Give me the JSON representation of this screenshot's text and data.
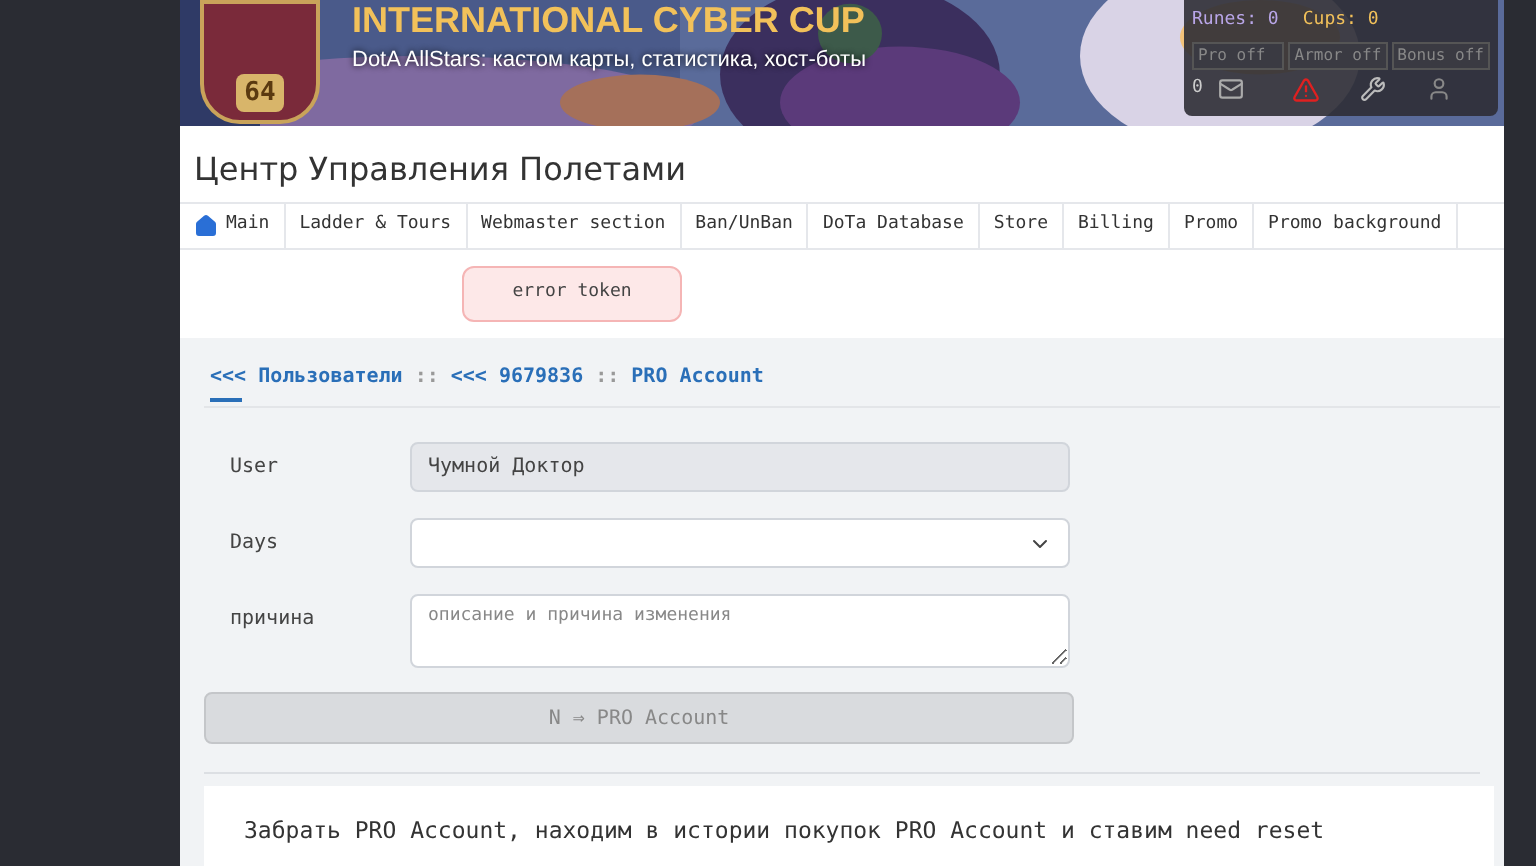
{
  "banner": {
    "title": "INTERNATIONAL CYBER CUP",
    "subtitle": "DotA AllStars: кастом карты, статистика, хост-боты",
    "level": "64",
    "stats": {
      "runes": "Runes: 0",
      "cups": "Cups: 0",
      "toggles": [
        {
          "label": "Pro off",
          "on": false
        },
        {
          "label": "Armor off",
          "on": false
        },
        {
          "label": "Bonus off",
          "on": false
        }
      ],
      "messages": "0"
    }
  },
  "page_title": "Центр Управления Полетами",
  "nav": [
    {
      "label": "Main",
      "kind": "home"
    },
    {
      "label": "Ladder & Tours",
      "kind": "text"
    },
    {
      "label": "Webmaster section",
      "kind": "text"
    },
    {
      "label": "Ban/UnBan",
      "kind": "text"
    },
    {
      "label": "DoTa Database",
      "kind": "text"
    },
    {
      "label": "Store",
      "kind": "text"
    },
    {
      "label": "Billing",
      "kind": "text"
    },
    {
      "label": "Promo",
      "kind": "text"
    },
    {
      "label": "Promo background",
      "kind": "text"
    }
  ],
  "alert": "error token",
  "breadcrumb": [
    {
      "label": "<<< Пользователи",
      "kind": "link"
    },
    {
      "label": "::",
      "kind": "sep"
    },
    {
      "label": "<<< 9679836",
      "kind": "link"
    },
    {
      "label": "::",
      "kind": "sep"
    },
    {
      "label": "PRO Account",
      "kind": "link"
    }
  ],
  "form": [
    {
      "label": "User",
      "kind": "readonly",
      "value": "Чумной Доктор"
    },
    {
      "label": "Days",
      "kind": "select"
    },
    {
      "label": "причина",
      "kind": "textarea",
      "placeholder": "описание и причина изменения"
    }
  ],
  "submit": {
    "label": "N ⇒ PRO Account",
    "disabled": true
  },
  "note": "Забрать PRO Account, находим в истории покупок PRO Account и ставим need reset"
}
